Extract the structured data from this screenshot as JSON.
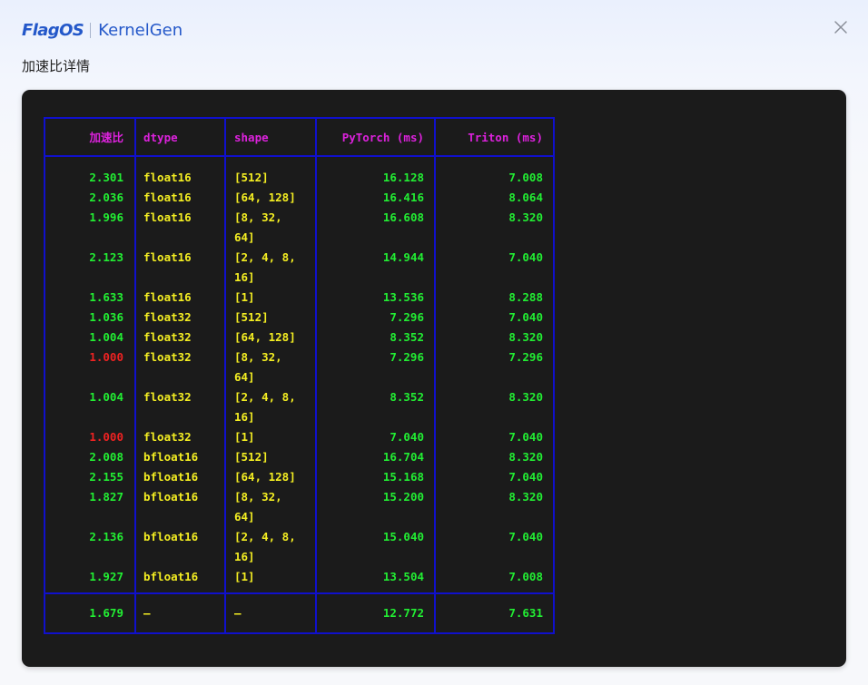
{
  "header": {
    "brand": "FlagOS",
    "product": "KernelGen"
  },
  "subtitle": "加速比详情",
  "table": {
    "columns": [
      "加速比",
      "dtype",
      "shape",
      "PyTorch (ms)",
      "Triton (ms)"
    ],
    "rows": [
      {
        "speedup": "2.301",
        "dtype": "float16",
        "shape": [
          "[512]"
        ],
        "pytorch": "16.128",
        "triton": "7.008",
        "status": "good"
      },
      {
        "speedup": "2.036",
        "dtype": "float16",
        "shape": [
          "[64, 128]"
        ],
        "pytorch": "16.416",
        "triton": "8.064",
        "status": "good"
      },
      {
        "speedup": "1.996",
        "dtype": "float16",
        "shape": [
          "[8, 32,",
          "64]"
        ],
        "pytorch": "16.608",
        "triton": "8.320",
        "status": "good"
      },
      {
        "speedup": "2.123",
        "dtype": "float16",
        "shape": [
          "[2, 4, 8,",
          "16]"
        ],
        "pytorch": "14.944",
        "triton": "7.040",
        "status": "good"
      },
      {
        "speedup": "1.633",
        "dtype": "float16",
        "shape": [
          "[1]"
        ],
        "pytorch": "13.536",
        "triton": "8.288",
        "status": "good"
      },
      {
        "speedup": "1.036",
        "dtype": "float32",
        "shape": [
          "[512]"
        ],
        "pytorch": "7.296",
        "triton": "7.040",
        "status": "good"
      },
      {
        "speedup": "1.004",
        "dtype": "float32",
        "shape": [
          "[64, 128]"
        ],
        "pytorch": "8.352",
        "triton": "8.320",
        "status": "good"
      },
      {
        "speedup": "1.000",
        "dtype": "float32",
        "shape": [
          "[8, 32,",
          "64]"
        ],
        "pytorch": "7.296",
        "triton": "7.296",
        "status": "bad"
      },
      {
        "speedup": "1.004",
        "dtype": "float32",
        "shape": [
          "[2, 4, 8,",
          "16]"
        ],
        "pytorch": "8.352",
        "triton": "8.320",
        "status": "good"
      },
      {
        "speedup": "1.000",
        "dtype": "float32",
        "shape": [
          "[1]"
        ],
        "pytorch": "7.040",
        "triton": "7.040",
        "status": "bad"
      },
      {
        "speedup": "2.008",
        "dtype": "bfloat16",
        "shape": [
          "[512]"
        ],
        "pytorch": "16.704",
        "triton": "8.320",
        "status": "good"
      },
      {
        "speedup": "2.155",
        "dtype": "bfloat16",
        "shape": [
          "[64, 128]"
        ],
        "pytorch": "15.168",
        "triton": "7.040",
        "status": "good"
      },
      {
        "speedup": "1.827",
        "dtype": "bfloat16",
        "shape": [
          "[8, 32,",
          "64]"
        ],
        "pytorch": "15.200",
        "triton": "8.320",
        "status": "good"
      },
      {
        "speedup": "2.136",
        "dtype": "bfloat16",
        "shape": [
          "[2, 4, 8,",
          "16]"
        ],
        "pytorch": "15.040",
        "triton": "7.040",
        "status": "good"
      },
      {
        "speedup": "1.927",
        "dtype": "bfloat16",
        "shape": [
          "[1]"
        ],
        "pytorch": "13.504",
        "triton": "7.008",
        "status": "good"
      }
    ],
    "footer": {
      "speedup": "1.679",
      "dtype": "—",
      "shape": "—",
      "pytorch": "12.772",
      "triton": "7.631"
    }
  },
  "colors": {
    "header_text": "#dd22dd",
    "good": "#22ee33",
    "bad": "#ee2222",
    "dtype_shape": "#f4ee22",
    "border": "#1010cc",
    "terminal_bg": "#1b1b1b",
    "brand": "#2458c9"
  },
  "icons": {
    "close": "close-icon"
  }
}
